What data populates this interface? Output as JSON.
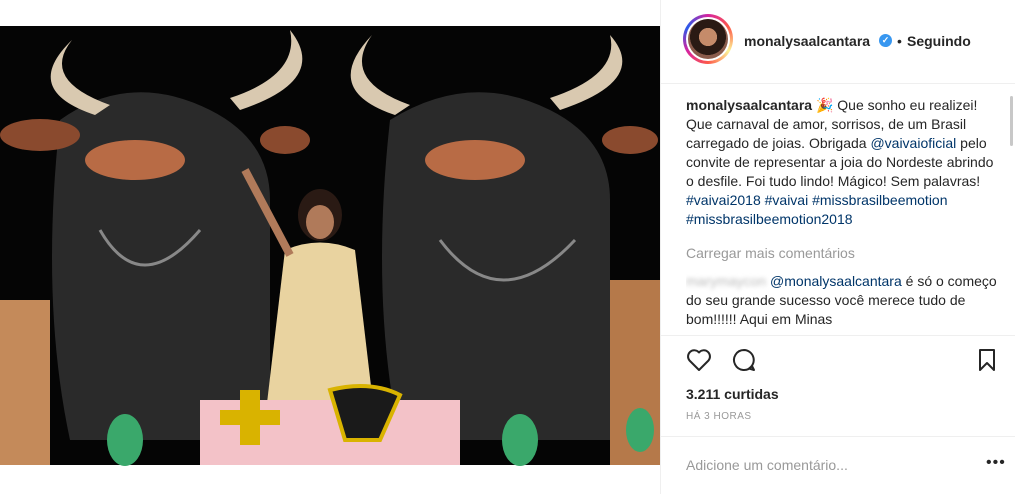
{
  "header": {
    "username": "monalysaalcantara",
    "verified_icon": "verified-badge-icon",
    "separator": "•",
    "follow_status": "Seguindo"
  },
  "caption": {
    "username": "monalysaalcantara",
    "emoji": "🎉",
    "text_1": " Que sonho eu realizei! Que carnaval de amor, sorrisos, de um Brasil carregado de joias. Obrigada ",
    "mention": "@vaivaioficial",
    "text_2": " pelo convite de representar a joia do Nordeste abrindo o desfile. Foi tudo lindo! Mágico! Sem palavras! ",
    "hashtags": [
      "#vaivai2018",
      "#vaivai",
      "#missbrasilbeemotion",
      "#missbrasilbeemotion2018"
    ]
  },
  "load_more": "Carregar mais comentários",
  "comment": {
    "username": "marymaycon",
    "mention": "@monalysaalcantara",
    "text": " é só o começo do seu grande sucesso você merece tudo de bom!!!!!! Aqui em Minas"
  },
  "actions": {
    "like_icon": "heart-icon",
    "comment_icon": "speech-bubble-icon",
    "save_icon": "bookmark-icon"
  },
  "likes": "3.211 curtidas",
  "timestamp": "HÁ 3 HORAS",
  "add_comment": {
    "placeholder": "Adicione um comentário...",
    "options_icon": "more-options-icon",
    "options_label": "•••"
  },
  "colors": {
    "link": "#003569",
    "muted": "#999999",
    "verified": "#3897f0",
    "border": "#efefef"
  }
}
